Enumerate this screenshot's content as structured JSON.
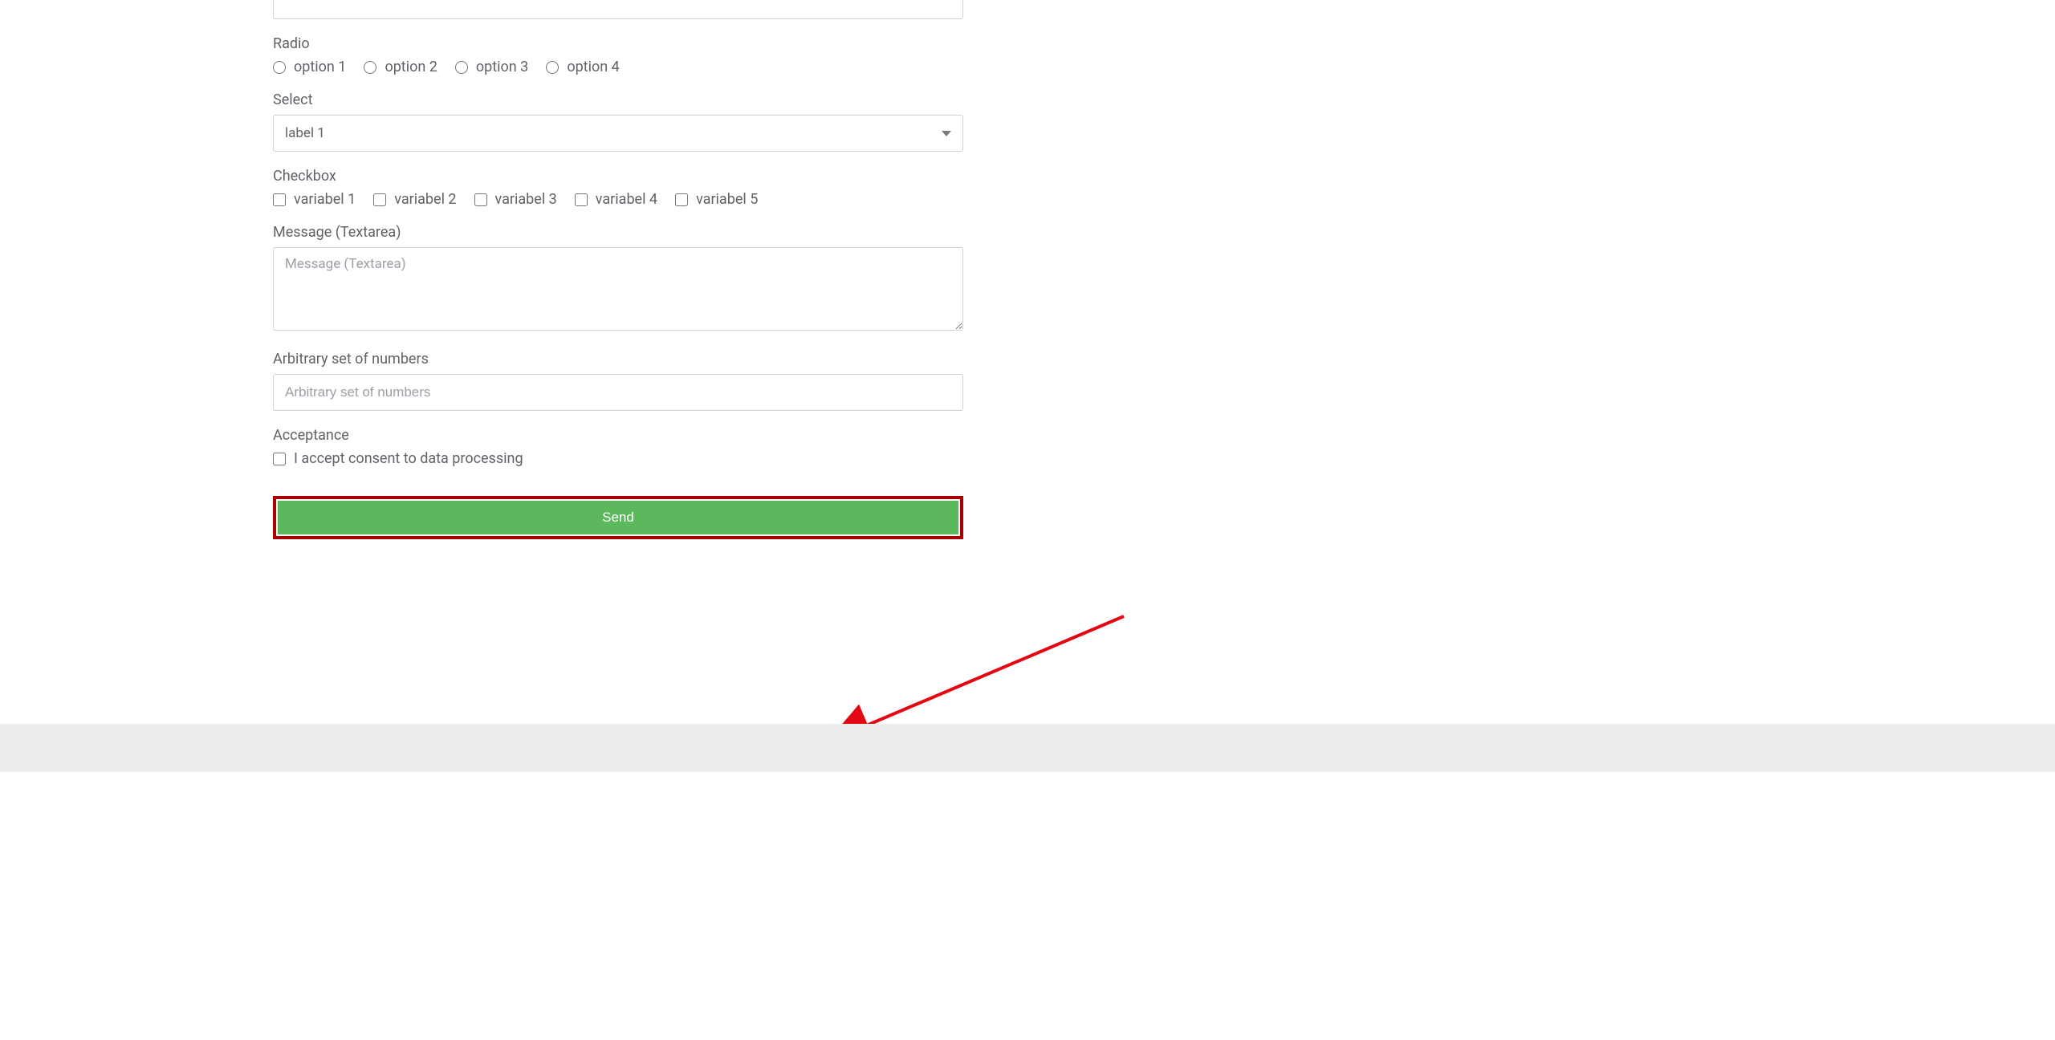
{
  "colors": {
    "send_bg": "#5cb85c",
    "highlight_border": "#a80000"
  },
  "top_input": {
    "value": ""
  },
  "radio": {
    "label": "Radio",
    "options": [
      "option 1",
      "option 2",
      "option 3",
      "option 4"
    ]
  },
  "select": {
    "label": "Select",
    "selected": "label 1"
  },
  "checkbox": {
    "label": "Checkbox",
    "options": [
      "variabel 1",
      "variabel 2",
      "variabel 3",
      "variabel 4",
      "variabel 5"
    ]
  },
  "message": {
    "label": "Message (Textarea)",
    "placeholder": "Message (Textarea)",
    "value": ""
  },
  "numbers": {
    "label": "Arbitrary set of numbers",
    "placeholder": "Arbitrary set of numbers",
    "value": ""
  },
  "acceptance": {
    "label": "Acceptance",
    "text": "I accept consent to data processing"
  },
  "send": {
    "label": "Send"
  }
}
